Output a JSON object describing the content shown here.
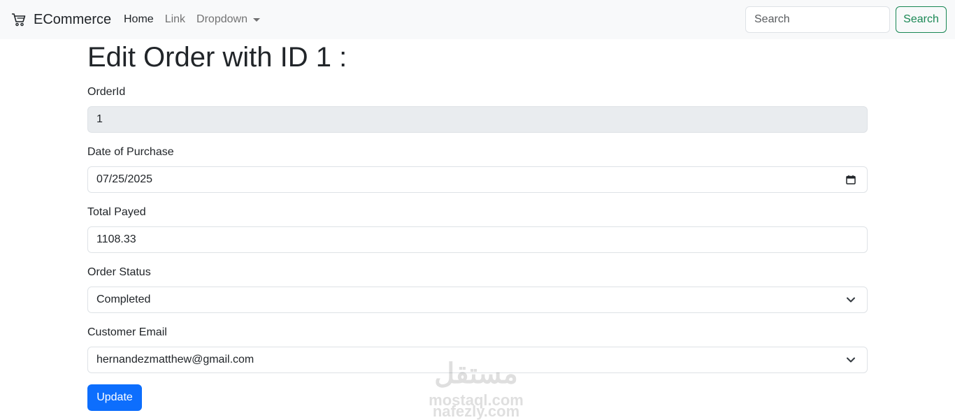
{
  "navbar": {
    "brand": "ECommerce",
    "brand_icon": "cart-icon",
    "links": [
      {
        "label": "Home"
      },
      {
        "label": "Link"
      },
      {
        "label": "Dropdown"
      }
    ],
    "search_placeholder": "Search",
    "search_button": "Search"
  },
  "page": {
    "title": "Edit Order with ID 1 :"
  },
  "form": {
    "order_id": {
      "label": "OrderId",
      "value": "1"
    },
    "date_of_purchase": {
      "label": "Date of Purchase",
      "value": "07/25/2025",
      "icon": "calendar-icon"
    },
    "total_payed": {
      "label": "Total Payed",
      "value": "1108.33"
    },
    "order_status": {
      "label": "Order Status",
      "value": "Completed",
      "icon": "chevron-down-icon"
    },
    "customer_email": {
      "label": "Customer Email",
      "value": "hernandezmatthew@gmail.com",
      "icon": "chevron-down-icon"
    },
    "update_button": "Update"
  },
  "watermark": {
    "line1": "مستقل",
    "line2": "mostaql.com",
    "line3": "nafezly.com"
  },
  "colors": {
    "navbar_bg": "#f8f9fa",
    "primary": "#0d6efd",
    "success": "#198754",
    "readonly_bg": "#e9ecef",
    "border": "#dee2e6"
  }
}
